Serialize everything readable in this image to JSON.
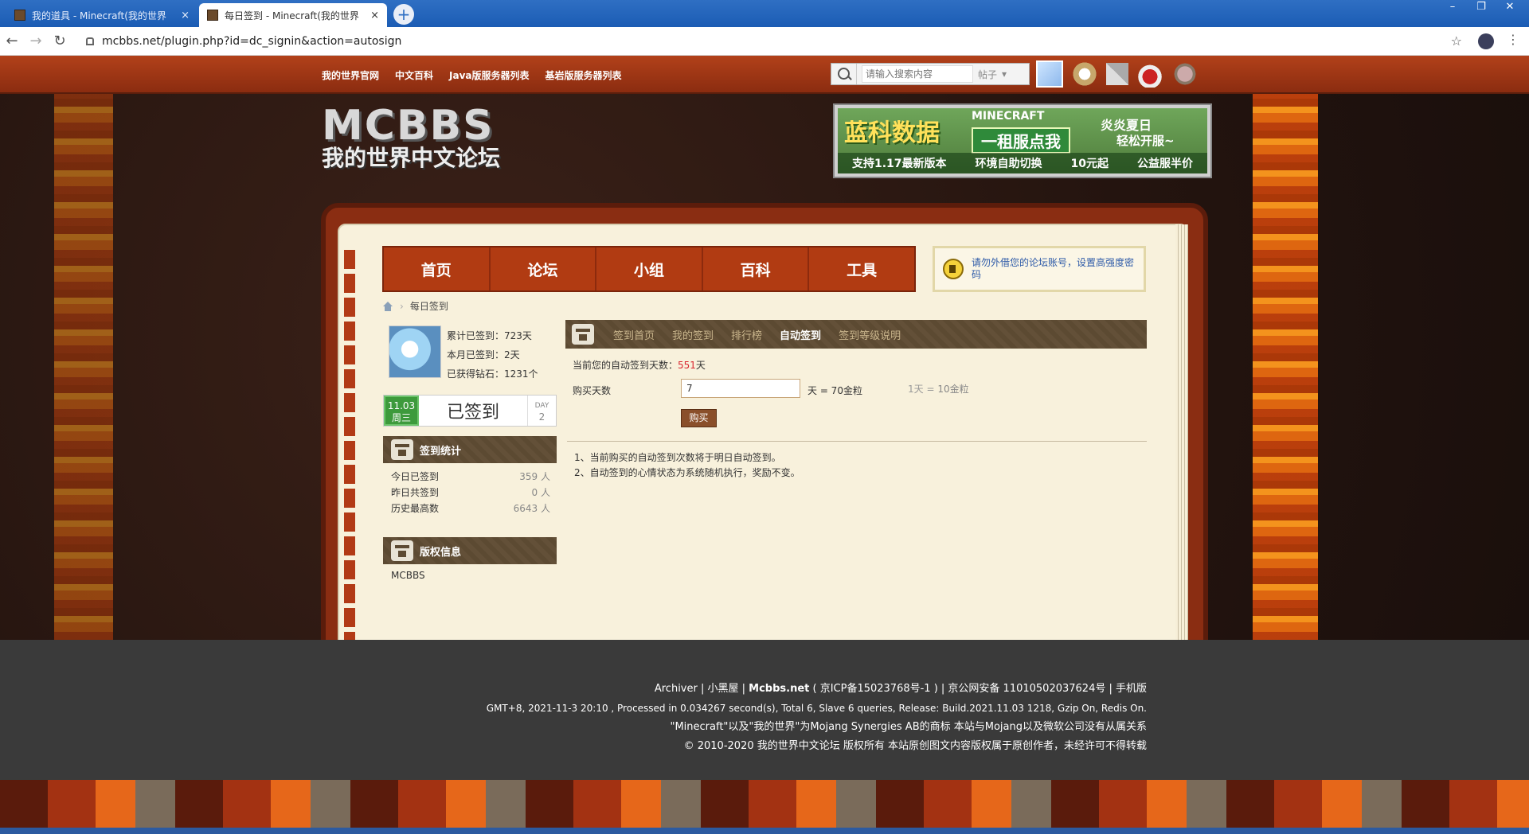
{
  "browser": {
    "tabs": [
      {
        "title": "我的道具 - Minecraft(我的世界",
        "close": "×"
      },
      {
        "title": "每日签到 - Minecraft(我的世界",
        "close": "×"
      }
    ],
    "new_tab": "+",
    "url": "mcbbs.net/plugin.php?id=dc_signin&action=autosign"
  },
  "topnav": {
    "links": [
      "我的世界官网",
      "中文百科",
      "Java版服务器列表",
      "基岩版服务器列表"
    ],
    "search_placeholder": "请输入搜索内容",
    "search_type": "帖子"
  },
  "logo": {
    "main": "MCBBS",
    "sub": "我的世界中文论坛"
  },
  "banner": {
    "brand": "蓝科数据",
    "minecraft": "MINECRAFT",
    "cta": "一租服点我",
    "slogan1": "炎炎夏日",
    "slogan2": "轻松开服~",
    "features": [
      "支持1.17最新版本",
      "环境自助切换",
      "10元起",
      "公益服半价"
    ]
  },
  "mainnav": [
    "首页",
    "论坛",
    "小组",
    "百科",
    "工具"
  ],
  "notice": "请勿外借您的论坛账号，设置高强度密码",
  "breadcrumb": {
    "current": "每日签到",
    "sep": "›"
  },
  "user_stats": {
    "total": "累计已签到：723天",
    "month": "本月已签到：2天",
    "diamonds": "已获得钻石：1231个"
  },
  "signin": {
    "date": "11.03",
    "weekday": "周三",
    "status": "已签到",
    "day_label": "DAY",
    "day_value": "2"
  },
  "sign_stats": {
    "title": "签到统计",
    "rows": [
      {
        "label": "今日已签到",
        "value": "359 人"
      },
      {
        "label": "昨日共签到",
        "value": "0 人"
      },
      {
        "label": "历史最高数",
        "value": "6643 人"
      }
    ]
  },
  "copyright_box": {
    "title": "版权信息",
    "text": "MCBBS"
  },
  "subnav": [
    "签到首页",
    "我的签到",
    "排行榜",
    "自动签到",
    "签到等级说明"
  ],
  "subnav_active": "自动签到",
  "autosign": {
    "days_label": "当前您的自动签到天数：",
    "days_value": "551",
    "days_unit": "天",
    "buy_label": "购买天数",
    "buy_value": "7",
    "price": "天 = 70金粒",
    "rate_a": "1天 =",
    "rate_b": "10金粒",
    "buy_button": "购买",
    "notes": [
      "1、当前购买的自动签到次数将于明日自动签到。",
      "2、自动签到的心情状态为系统随机执行，奖励不变。"
    ]
  },
  "footer": {
    "line1_prefix": "Archiver | 小黑屋 | ",
    "line1_site": "Mcbbs.net",
    "line1_rest": " ( 京ICP备15023768号-1 ) | 京公网安备 11010502037624号 | 手机版",
    "line2": "GMT+8, 2021-11-3 20:10 , Processed in 0.034267 second(s), Total 6, Slave 6 queries, Release: Build.2021.11.03 1218, Gzip On, Redis On.",
    "line3": "\"Minecraft\"以及\"我的世界\"为Mojang Synergies AB的商标 本站与Mojang以及微软公司没有从属关系",
    "line4": "© 2010-2020 我的世界中文论坛 版权所有 本站原创图文内容版权属于原创作者，未经许可不得转载"
  }
}
